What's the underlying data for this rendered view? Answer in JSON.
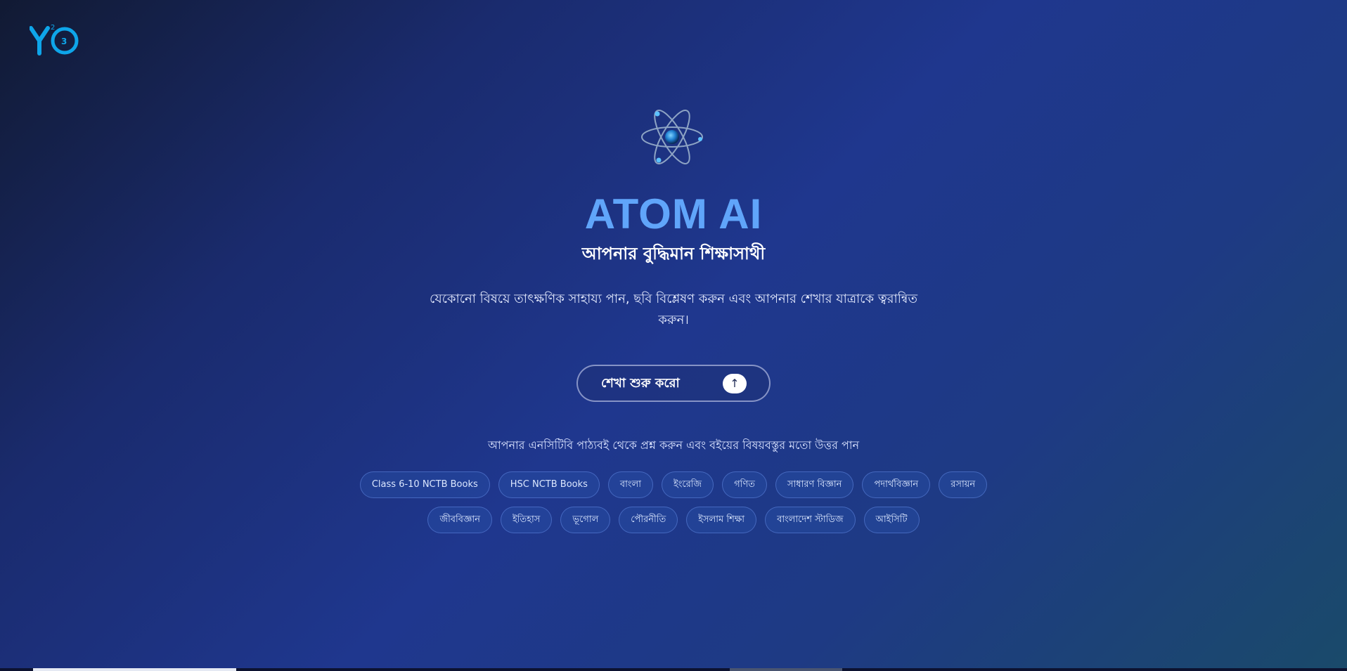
{
  "logo": {
    "text": "YO",
    "superscript": "2",
    "small": "3"
  },
  "hero": {
    "title": "ATOM AI",
    "subtitle": "আপনার বুদ্ধিমান শিক্ষাসাথী",
    "description": "যেকোনো বিষয়ে তাৎক্ষণিক সাহায্য পান, ছবি বিশ্লেষণ করুন এবং আপনার শেখার যাত্রাকে ত্বরান্বিত করুন।"
  },
  "cta": {
    "label": "শেখা শুরু করো",
    "arrow": "↑"
  },
  "books_note": "আপনার এনসিটিবি পাঠ্যবই থেকে প্রশ্ন করুন এবং বইয়ের বিষয়বস্তুর মতো উত্তর পান",
  "chips_row1": [
    "Class 6-10 NCTB Books",
    "HSC NCTB Books",
    "বাংলা",
    "ইংরেজি",
    "গণিত",
    "সাধারণ বিজ্ঞান",
    "পদার্থবিজ্ঞান",
    "রসায়ন"
  ],
  "chips_row2": [
    "জীববিজ্ঞান",
    "ইতিহাস",
    "ভূগোল",
    "পৌরনীতি",
    "ইসলাম শিক্ষা",
    "বাংলাদেশ স্টাডিজ",
    "আইসিটি"
  ],
  "colors": {
    "title": "#60a5fa",
    "logo": "#0ea5e9",
    "chip_bg": "#23439a"
  }
}
